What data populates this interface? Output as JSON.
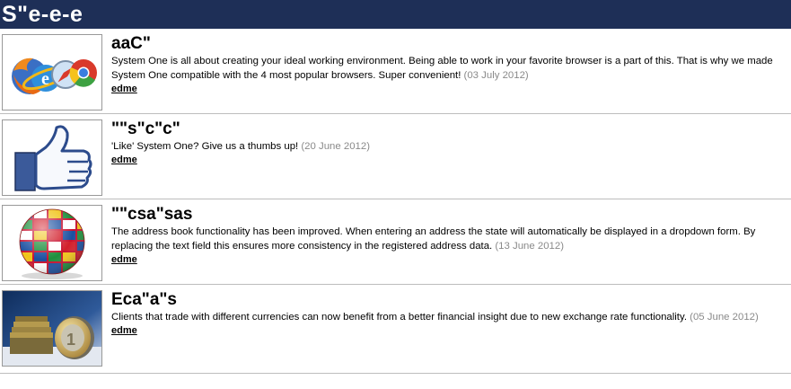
{
  "header": {
    "title": "S\"e-e-e"
  },
  "news": [
    {
      "title": "aaC\"",
      "text": "System One is all about creating your ideal working environment. Being able to work in your favorite browser is a part of this. That is why we made System One compatible with the 4 most popular browsers. Super convenient!",
      "date": "(03 July 2012)",
      "link": "edme",
      "icon": "browsers-icon"
    },
    {
      "title": "\"\"s\"c\"c\"",
      "text": "'Like' System One? Give us a thumbs up!",
      "date": "(20 June 2012)",
      "link": "edme",
      "icon": "thumbs-up-icon"
    },
    {
      "title": "\"\"csa\"sas",
      "text": "The address book functionality has been improved. When entering an address the state will automatically be displayed in a dropdown form. By replacing the text field this ensures more consistency in the registered address data.",
      "date": "(13 June 2012)",
      "link": "edme",
      "icon": "flag-globe-icon"
    },
    {
      "title": "Eca\"a\"s",
      "text": "Clients that trade with different currencies can now benefit from a better financial insight due to new exchange rate functionality.",
      "date": "(05 June 2012)",
      "link": "edme",
      "icon": "euro-coins-icon"
    }
  ]
}
